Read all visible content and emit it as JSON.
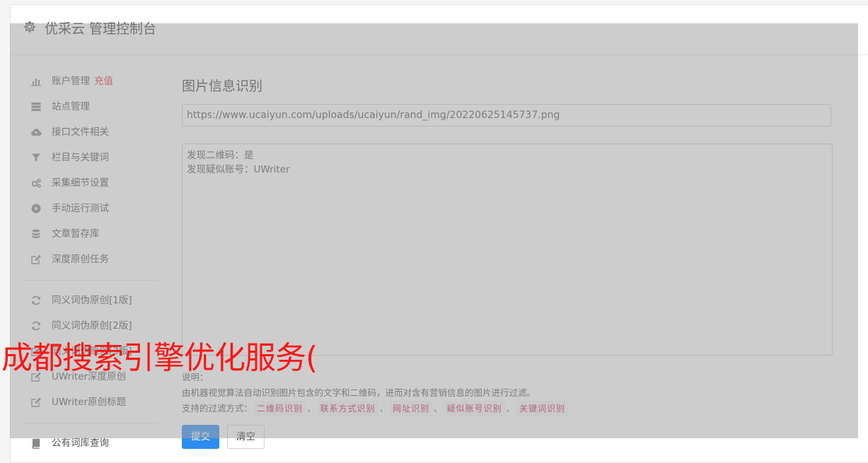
{
  "app": {
    "title": "优采云 管理控制台",
    "icon": "gear-icon"
  },
  "sidebar": {
    "groups": [
      [
        {
          "icon": "bar-chart-icon",
          "label": "账户管理",
          "badge": "充值"
        },
        {
          "icon": "server-icon",
          "label": "站点管理"
        },
        {
          "icon": "cloud-upload-icon",
          "label": "接口文件相关"
        },
        {
          "icon": "filter-icon",
          "label": "栏目与关键词"
        },
        {
          "icon": "gears-icon",
          "label": "采集细节设置"
        },
        {
          "icon": "play-circle-icon",
          "label": "手动运行测试"
        },
        {
          "icon": "database-icon",
          "label": "文章暂存库"
        },
        {
          "icon": "edit-icon",
          "label": "深度原创任务"
        }
      ],
      [
        {
          "icon": "refresh-icon",
          "label": "同义词伪原创[1版]"
        },
        {
          "icon": "refresh-icon",
          "label": "同义词伪原创[2版]"
        },
        {
          "icon": "edit-icon",
          "label": "同义词伪原创[3版]"
        },
        {
          "icon": "edit-icon",
          "label": "UWriter深度原创"
        },
        {
          "icon": "edit-icon",
          "label": "UWriter原创标题"
        }
      ],
      [
        {
          "icon": "book-icon",
          "label": "公有词库查询"
        }
      ]
    ]
  },
  "main": {
    "heading": "图片信息识别",
    "url_value": "https://www.ucaiyun.com/uploads/ucaiyun/rand_img/20220625145737.png",
    "result_lines": [
      "发现二维码：是",
      "发现疑似账号：UWriter"
    ],
    "note_label": "说明：",
    "note_desc": "由机器视觉算法自动识别图片包含的文字和二维码，进而对含有营销信息的图片进行过滤。",
    "filter_label": "支持的过滤方式：",
    "filters": [
      "二维码识别",
      "联系方式识别",
      "网址识别",
      "疑似账号识别",
      "关键词识别"
    ],
    "filter_sep": "、",
    "submit_label": "提交",
    "clear_label": "清空"
  },
  "overlay_text": "成都搜索引擎优化服务(",
  "colors": {
    "accent": "#2d8cf0",
    "badge": "#e33333",
    "watermark": "#ff1616",
    "code_tag": "#c7254e"
  }
}
